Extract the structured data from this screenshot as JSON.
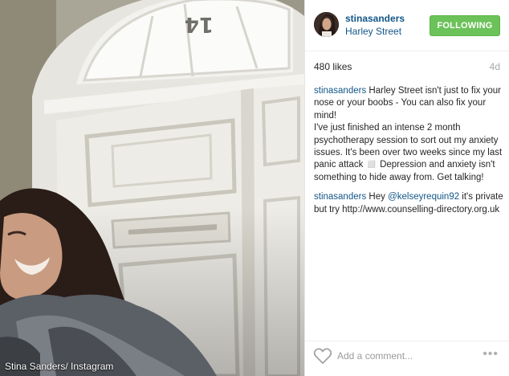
{
  "photo": {
    "door_number": "14",
    "credit": "Stina Sanders/ Instagram"
  },
  "header": {
    "username": "stinasanders",
    "location": "Harley Street",
    "follow_label": "FOLLOWING"
  },
  "stats": {
    "likes": "480 likes",
    "age": "4d"
  },
  "comments": [
    {
      "author": "stinasanders",
      "lines": [
        "Harley Street isn't just to fix your nose or your boobs - You can also fix your mind!",
        "I've just finished an intense 2 month psychotherapy session to sort out my anxiety issues. It's been over two weeks since my last panic attack ◻️ Depression and anxiety isn't something to hide away from. Get talking!"
      ]
    },
    {
      "author": "stinasanders",
      "text_before": "Hey ",
      "mention": "@kelseyrequin92",
      "text_after": " it's private but try http://www.counselling-directory.org.uk"
    }
  ],
  "footer": {
    "comment_placeholder": "Add a comment...",
    "more_label": "•••"
  },
  "colors": {
    "link_blue": "#125688",
    "follow_green": "#6bc259"
  },
  "icons": [
    "heart-icon",
    "more-options-icon"
  ]
}
